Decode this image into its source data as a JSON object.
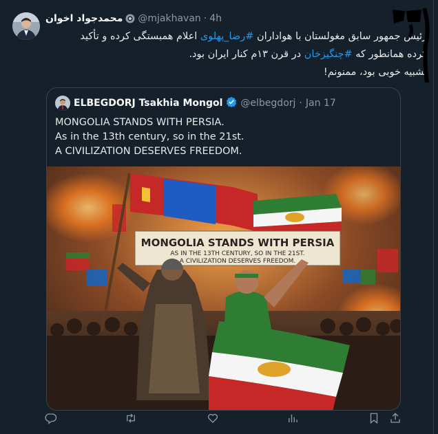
{
  "author": {
    "name": "محمدجواد اخوان",
    "handle": "@mjakhavan",
    "time": "4h"
  },
  "tweet": {
    "line1_pre": "رئیس جمهور سابق مغولستان با هواداران ",
    "line1_link": "#رضا_پهلوی",
    "line1_post": " اعلام همبستگی کرده و تأکید",
    "line2_pre": "کرده همانطور که ",
    "line2_link": "#چنگیزخان",
    "line2_post": " در قرن ۱۳م کنار ایران بود.",
    "line3": "تشبیه خوبی بود، ممنونم!"
  },
  "quote": {
    "name": "ELBEGDORJ Tsakhia Mongol",
    "handle": "@elbegdorj",
    "date": "Jan 17",
    "lines": [
      "MONGOLIA STANDS WITH PERSIA.",
      "As in the 13th century, so in the 21st.",
      "A CIVILIZATION DESERVES FREEDOM."
    ],
    "banner": {
      "line1": "MONGOLIA STANDS WITH PERSIA",
      "line2": "AS IN THE 13TH CENTURY, SO IN THE 21ST.",
      "line3": "A CIVILIZATION DESERVES FREEDOM."
    }
  },
  "icons": {
    "reply": "reply-icon",
    "retweet": "retweet-icon",
    "like": "like-icon",
    "views": "views-icon",
    "bookmark": "bookmark-icon",
    "share": "share-icon",
    "verified": "verified-badge-icon"
  },
  "colors": {
    "background": "#15202b",
    "link": "#1d9bf0",
    "muted": "#8b98a5",
    "border": "#38444d",
    "verified": "#1d9bf0"
  }
}
